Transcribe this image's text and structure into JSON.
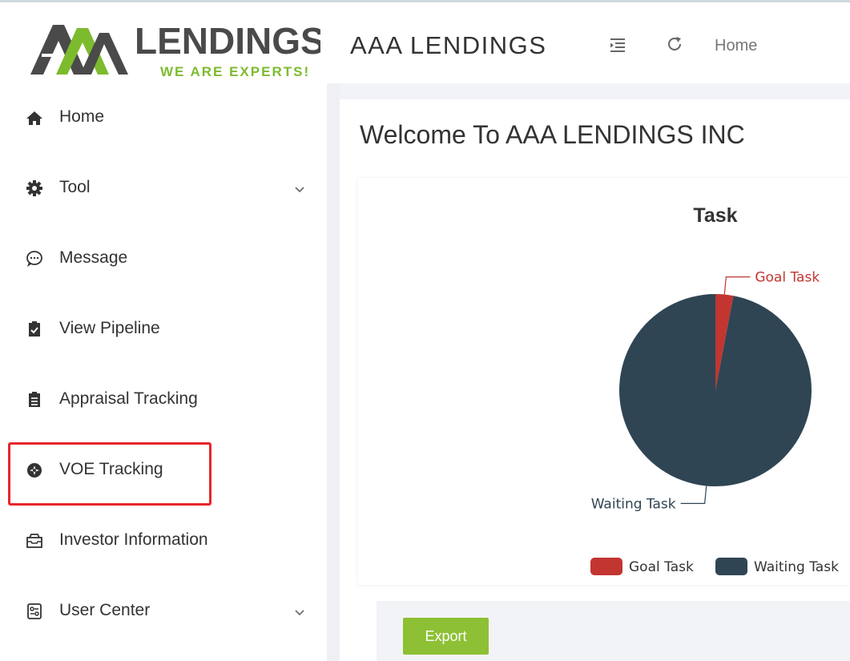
{
  "header": {
    "logo_text": "LENDINGS",
    "logo_tagline": "WE ARE EXPERTS!",
    "app_title": "AAA LENDINGS",
    "breadcrumb": "Home",
    "menu_icon": "menu-fold-icon",
    "refresh_icon": "refresh-icon"
  },
  "sidebar": {
    "items": [
      {
        "label": "Home",
        "icon": "home-icon",
        "has_children": false
      },
      {
        "label": "Tool",
        "icon": "gear-icon",
        "has_children": true
      },
      {
        "label": "Message",
        "icon": "message-icon",
        "has_children": false
      },
      {
        "label": "View Pipeline",
        "icon": "clipboard-check-icon",
        "has_children": false
      },
      {
        "label": "Appraisal Tracking",
        "icon": "clipboard-list-icon",
        "has_children": false
      },
      {
        "label": "VOE Tracking",
        "icon": "compass-icon",
        "has_children": false,
        "highlighted": true
      },
      {
        "label": "Investor Information",
        "icon": "inbox-icon",
        "has_children": false
      },
      {
        "label": "User Center",
        "icon": "user-settings-icon",
        "has_children": true
      }
    ]
  },
  "main": {
    "welcome": "Welcome To AAA LENDINGS INC",
    "export_label": "Export"
  },
  "colors": {
    "brand_dark": "#4a4a4a",
    "brand_green": "#7dbb2e",
    "goal": "#c23531",
    "waiting": "#2f4554",
    "export_button": "#8dc034",
    "highlight_box": "#e8262a"
  },
  "chart_data": {
    "type": "pie",
    "title": "Task",
    "slices": [
      {
        "name": "Goal Task",
        "value": 3,
        "color": "#c23531"
      },
      {
        "name": "Waiting Task",
        "value": 97,
        "color": "#2f4554"
      }
    ],
    "legend": [
      "Goal Task",
      "Waiting Task"
    ],
    "legend_placement": "bottom-center"
  }
}
